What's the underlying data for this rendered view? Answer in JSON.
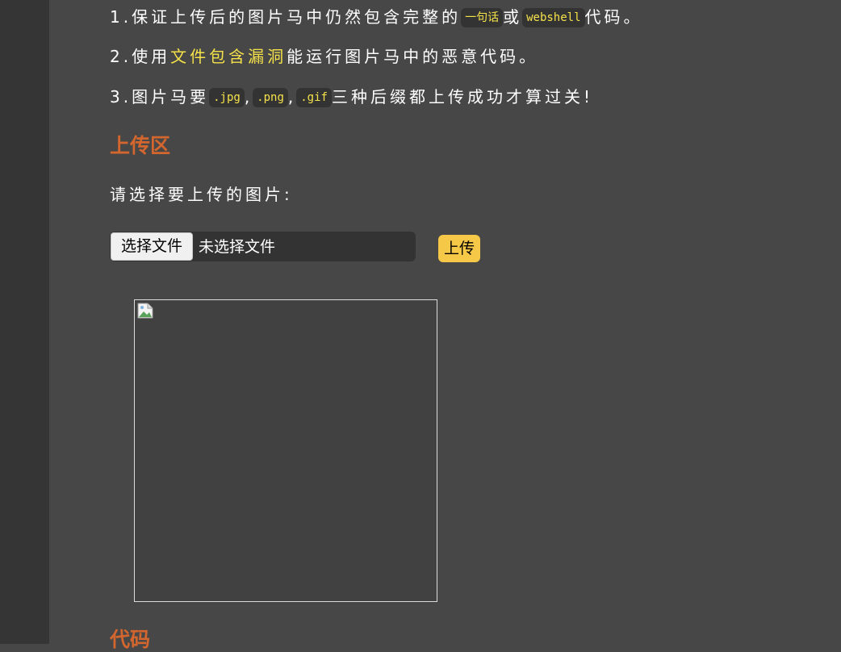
{
  "rules": {
    "r1": {
      "prefix": "1.保证上传后的图片马中仍然包含完整的",
      "code1": "一句话",
      "mid": "或",
      "code2": "webshell",
      "suffix": "代码。"
    },
    "r2": {
      "prefix": "2.使用",
      "highlight": "文件包含漏洞",
      "suffix": "能运行图片马中的恶意代码。"
    },
    "r3": {
      "prefix": "3.图片马要",
      "ext1": ".jpg",
      "sep1": ",",
      "ext2": ".png",
      "sep2": ",",
      "ext3": ".gif",
      "suffix": "三种后缀都上传成功才算过关!"
    }
  },
  "upload": {
    "title": "上传区",
    "prompt": "请选择要上传的图片:",
    "choose_label": "选择文件",
    "file_status": "未选择文件",
    "submit_label": "上传"
  },
  "code_section": {
    "title": "代码"
  },
  "colors": {
    "background": "#474747",
    "sidebar": "#353535",
    "accent_orange": "#d2662e",
    "code_yellow": "#f5e24a",
    "button_yellow": "#f6c847"
  },
  "icons": {
    "preview": "broken-image-icon"
  }
}
